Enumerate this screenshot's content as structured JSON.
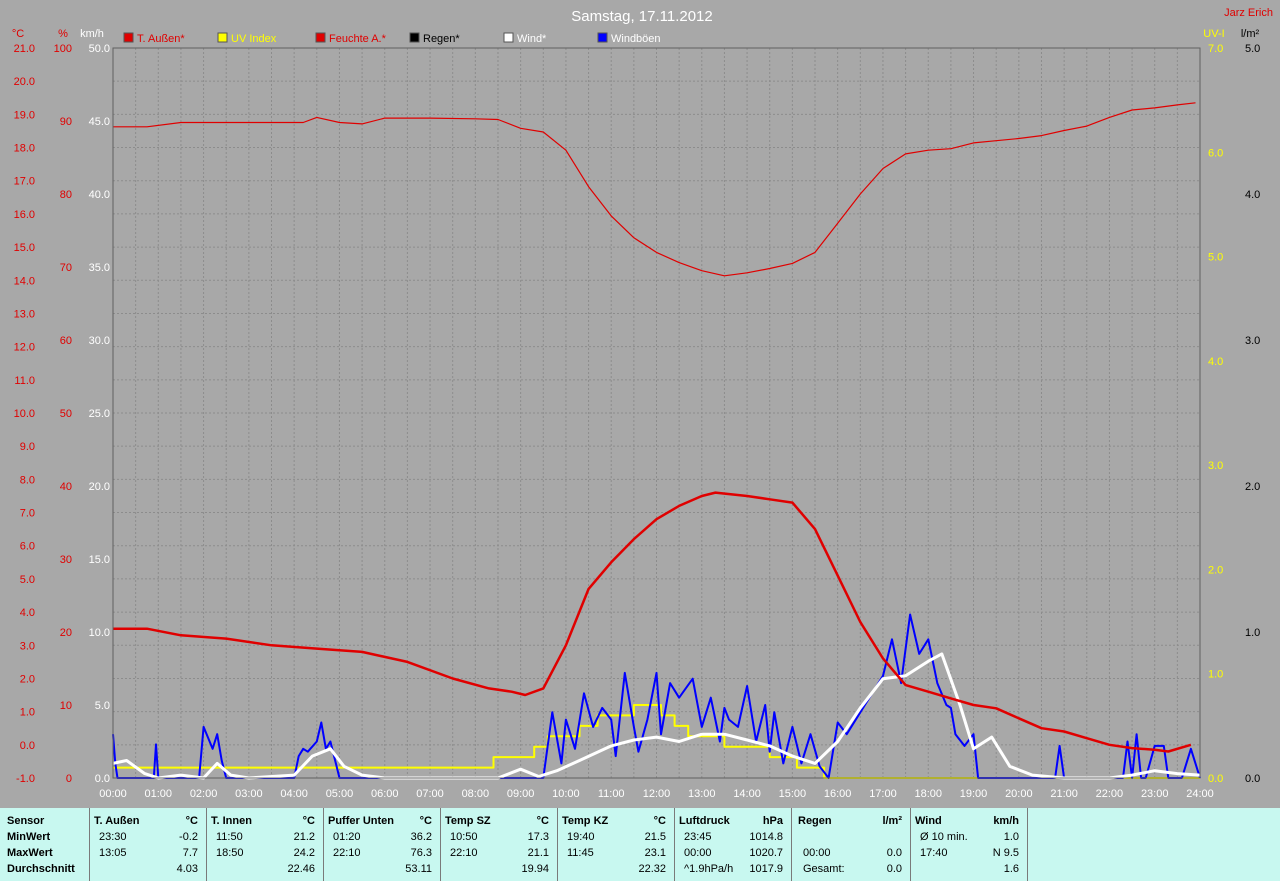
{
  "header": {
    "title": "Samstag, 17.11.2012",
    "author": "Jarz Erich"
  },
  "colors": {
    "background": "#a8a8a8",
    "plot_bg": "#a8a8a8",
    "red": "#e00000",
    "yellow": "#ffff00",
    "black": "#000000",
    "white": "#ffffff",
    "blue": "#0000ff",
    "table_bg": "#c8f8f0"
  },
  "legend": [
    {
      "label": "T. Außen*",
      "color": "#e00000",
      "text_color": "#e00000"
    },
    {
      "label": "UV Index",
      "color": "#ffff00",
      "text_color": "#ffff00"
    },
    {
      "label": "Feuchte A.*",
      "color": "#e00000",
      "text_color": "#e00000"
    },
    {
      "label": "Regen*",
      "color": "#000000",
      "text_color": "#000000"
    },
    {
      "label": "Wind*",
      "color": "#ffffff",
      "text_color": "#ffffff"
    },
    {
      "label": "Windböen",
      "color": "#0000ff",
      "text_color": "#ffffff"
    }
  ],
  "axes": {
    "temp": {
      "unit": "°C",
      "min": -1,
      "max": 21,
      "step": 1,
      "color": "#e00000"
    },
    "humidity": {
      "unit": "%",
      "min": 0,
      "max": 100,
      "step": 10,
      "color": "#e00000"
    },
    "wind": {
      "unit": "km/h",
      "min": 0,
      "max": 50,
      "step": 5,
      "color": "#ffffff"
    },
    "uv": {
      "unit": "UV-I",
      "min": 0,
      "max": 7,
      "step": 1,
      "color": "#ffff00"
    },
    "rain": {
      "unit": "l/m²",
      "min": 0,
      "max": 5,
      "step": 1,
      "color": "#000000"
    },
    "time_ticks": [
      "00:00",
      "01:00",
      "02:00",
      "03:00",
      "04:00",
      "05:00",
      "06:00",
      "07:00",
      "08:00",
      "09:00",
      "10:00",
      "11:00",
      "12:00",
      "13:00",
      "14:00",
      "15:00",
      "16:00",
      "17:00",
      "18:00",
      "19:00",
      "20:00",
      "21:00",
      "22:00",
      "23:00",
      "24:00"
    ]
  },
  "chart_data": {
    "type": "line",
    "title": "Samstag, 17.11.2012",
    "x_unit": "hours",
    "xlim": [
      0,
      24
    ],
    "grid": true,
    "legend_position": "top",
    "series": [
      {
        "name": "T. Außen*",
        "axis": "temp",
        "color": "#e00000",
        "x": [
          0,
          0.75,
          1.5,
          2.5,
          3.5,
          4.5,
          5.5,
          6.5,
          7.5,
          8.3,
          8.8,
          9.1,
          9.5,
          10,
          10.5,
          11,
          11.5,
          12,
          12.5,
          13,
          13.3,
          14,
          14.5,
          15,
          15.5,
          16,
          16.5,
          17,
          17.5,
          18,
          18.5,
          19,
          19.5,
          20,
          20.5,
          21,
          21.5,
          22,
          22.5,
          23,
          23.3,
          23.8
        ],
        "y": [
          3.5,
          3.5,
          3.3,
          3.2,
          3.0,
          2.9,
          2.8,
          2.5,
          2.0,
          1.7,
          1.6,
          1.5,
          1.7,
          3.0,
          4.7,
          5.5,
          6.2,
          6.8,
          7.2,
          7.5,
          7.6,
          7.5,
          7.4,
          7.3,
          6.5,
          5.1,
          3.7,
          2.6,
          1.8,
          1.6,
          1.4,
          1.2,
          1.1,
          0.8,
          0.5,
          0.4,
          0.2,
          0.0,
          -0.1,
          -0.15,
          -0.2,
          0.0
        ]
      },
      {
        "name": "Feuchte A.*",
        "axis": "humidity",
        "color": "#e00000",
        "x": [
          0,
          0.75,
          1.5,
          2.5,
          3.5,
          4.2,
          4.5,
          5,
          5.5,
          6,
          7,
          8,
          8.5,
          9,
          9.5,
          10,
          10.5,
          11,
          11.5,
          12,
          12.5,
          13,
          13.5,
          14,
          14.5,
          15,
          15.5,
          16,
          16.5,
          17,
          17.5,
          18,
          18.5,
          19,
          19.5,
          20,
          20.5,
          21,
          21.5,
          22,
          22.5,
          23,
          23.5,
          23.9
        ],
        "y": [
          89.2,
          89.2,
          89.8,
          89.8,
          89.8,
          89.8,
          90.5,
          89.8,
          89.6,
          90.4,
          90.4,
          90.3,
          90.2,
          89.0,
          88.5,
          86.0,
          81.0,
          77.0,
          74.0,
          72.0,
          70.6,
          69.5,
          68.8,
          69.2,
          69.8,
          70.5,
          72.0,
          76.0,
          80.0,
          83.5,
          85.5,
          86.0,
          86.2,
          87.0,
          87.3,
          87.6,
          88.0,
          88.7,
          89.3,
          90.5,
          91.5,
          91.8,
          92.2,
          92.5
        ]
      },
      {
        "name": "UV Index",
        "axis": "uv",
        "color": "#ffff00",
        "x": [
          0,
          8.4,
          8.4,
          9.3,
          9.3,
          9.6,
          9.6,
          10.3,
          10.3,
          10.7,
          10.7,
          11.5,
          11.5,
          12.1,
          12.1,
          12.4,
          12.4,
          12.7,
          12.7,
          13.5,
          13.5,
          14.5,
          14.5,
          15.1,
          15.1,
          15.7,
          15.7,
          20.1,
          20.1,
          24
        ],
        "y": [
          0.1,
          0.1,
          0.2,
          0.2,
          0.3,
          0.3,
          0.4,
          0.4,
          0.5,
          0.5,
          0.6,
          0.6,
          0.7,
          0.7,
          0.6,
          0.6,
          0.5,
          0.5,
          0.4,
          0.4,
          0.3,
          0.3,
          0.2,
          0.2,
          0.1,
          0.1,
          0.0,
          0.0,
          0.0,
          0.0
        ]
      },
      {
        "name": "Regen*",
        "axis": "rain",
        "color": "#000000",
        "x": [
          0,
          24
        ],
        "y": [
          0,
          0
        ]
      },
      {
        "name": "Wind*",
        "axis": "wind",
        "color": "#ffffff",
        "x": [
          0,
          0.3,
          0.7,
          1.0,
          1.5,
          2.0,
          2.3,
          2.6,
          3.0,
          4.0,
          4.4,
          4.8,
          5.1,
          5.5,
          6.0,
          7.0,
          8.5,
          9.0,
          9.4,
          9.8,
          10.3,
          11.0,
          11.5,
          12.0,
          12.5,
          13.0,
          13.5,
          14.0,
          14.5,
          15.0,
          15.5,
          16.0,
          16.5,
          17.0,
          17.5,
          18.0,
          18.3,
          18.7,
          19.0,
          19.4,
          19.8,
          20.3,
          21.0,
          22.0,
          22.5,
          23.0,
          23.5,
          24.0
        ],
        "y": [
          1.0,
          1.2,
          0.3,
          0.0,
          0.2,
          0.0,
          1.0,
          0.2,
          0.0,
          0.2,
          1.5,
          2.0,
          0.8,
          0.2,
          0.0,
          0.0,
          0.0,
          0.6,
          0.1,
          0.5,
          1.2,
          2.2,
          2.6,
          2.8,
          2.5,
          3.0,
          3.0,
          2.6,
          2.2,
          1.5,
          1.0,
          2.5,
          4.8,
          6.8,
          7.0,
          8.0,
          8.5,
          5.0,
          2.0,
          2.8,
          0.8,
          0.2,
          0.0,
          0.0,
          0.2,
          0.5,
          0.3,
          0.2
        ]
      },
      {
        "name": "Windböen",
        "axis": "wind",
        "color": "#0000ff",
        "x": [
          0,
          0.05,
          0.1,
          0.9,
          0.95,
          1.0,
          1.9,
          2.0,
          2.2,
          2.3,
          2.4,
          2.5,
          4.0,
          4.1,
          4.2,
          4.3,
          4.5,
          4.6,
          4.7,
          4.8,
          5.0,
          9.5,
          9.7,
          9.9,
          10.0,
          10.2,
          10.4,
          10.6,
          10.8,
          11.0,
          11.1,
          11.3,
          11.5,
          11.6,
          11.8,
          12.0,
          12.1,
          12.3,
          12.5,
          12.8,
          13.0,
          13.2,
          13.4,
          13.5,
          13.6,
          13.8,
          14.0,
          14.2,
          14.4,
          14.5,
          14.6,
          14.8,
          15.0,
          15.2,
          15.4,
          15.6,
          15.8,
          16.0,
          16.2,
          16.5,
          16.8,
          17.0,
          17.2,
          17.4,
          17.6,
          17.8,
          18.0,
          18.2,
          18.4,
          18.5,
          18.6,
          18.8,
          19.0,
          19.1,
          19.3,
          20.8,
          20.9,
          21.0,
          21.2,
          22.3,
          22.4,
          22.5,
          22.6,
          22.7,
          22.8,
          23.0,
          23.2,
          23.3,
          23.5,
          23.6,
          23.8,
          24.0
        ],
        "y": [
          3.0,
          1.0,
          0.0,
          0.0,
          2.3,
          0.0,
          0.0,
          3.5,
          2.0,
          3.0,
          1.2,
          0.0,
          0.0,
          1.5,
          2.0,
          1.8,
          2.5,
          3.8,
          2.0,
          2.5,
          0.0,
          0.0,
          4.5,
          1.0,
          4.0,
          2.0,
          5.8,
          3.5,
          4.8,
          4.0,
          1.5,
          7.2,
          3.5,
          1.8,
          4.0,
          7.2,
          3.0,
          6.5,
          5.5,
          6.8,
          3.5,
          5.5,
          2.5,
          4.8,
          4.0,
          3.5,
          6.3,
          2.5,
          5.0,
          1.8,
          4.5,
          1.0,
          3.5,
          1.0,
          3.0,
          0.8,
          0.0,
          3.8,
          3.0,
          4.5,
          6.0,
          7.0,
          9.5,
          6.5,
          11.2,
          8.5,
          9.5,
          6.5,
          5.0,
          4.8,
          3.0,
          2.2,
          3.0,
          0.0,
          0.0,
          0.0,
          2.2,
          0.0,
          0.0,
          0.0,
          2.5,
          0.0,
          3.0,
          0.0,
          0.0,
          2.2,
          2.2,
          0.0,
          0.0,
          0.0,
          2.0,
          0.0
        ]
      }
    ]
  },
  "stats": {
    "columns": [
      {
        "id": "sensor",
        "header": "Sensor",
        "rows": [
          "MinWert",
          "MaxWert",
          "Durchschnitt"
        ]
      },
      {
        "id": "t-aussen",
        "header": "T. Außen",
        "unit": "°C",
        "rows": [
          [
            "23:30",
            "-0.2"
          ],
          [
            "13:05",
            "7.7"
          ],
          [
            "",
            "4.03"
          ]
        ]
      },
      {
        "id": "t-innen",
        "header": "T. Innen",
        "unit": "°C",
        "rows": [
          [
            "11:50",
            "21.2"
          ],
          [
            "18:50",
            "24.2"
          ],
          [
            "",
            "22.46"
          ]
        ]
      },
      {
        "id": "puffer-unten",
        "header": "Puffer Unten",
        "unit": "°C",
        "rows": [
          [
            "01:20",
            "36.2"
          ],
          [
            "22:10",
            "76.3"
          ],
          [
            "",
            "53.11"
          ]
        ]
      },
      {
        "id": "temp-sz",
        "header": "Temp SZ",
        "unit": "°C",
        "rows": [
          [
            "10:50",
            "17.3"
          ],
          [
            "22:10",
            "21.1"
          ],
          [
            "",
            "19.94"
          ]
        ]
      },
      {
        "id": "temp-kz",
        "header": "Temp KZ",
        "unit": "°C",
        "rows": [
          [
            "19:40",
            "21.5"
          ],
          [
            "11:45",
            "23.1"
          ],
          [
            "",
            "22.32"
          ]
        ]
      },
      {
        "id": "luftdruck",
        "header": "Luftdruck",
        "unit": "hPa",
        "rows": [
          [
            "23:45",
            "1014.8"
          ],
          [
            "00:00",
            "1020.7"
          ],
          [
            "^1.9hPa/h",
            "1017.9"
          ]
        ]
      },
      {
        "id": "regen",
        "header": "Regen",
        "unit": "l/m²",
        "rows": [
          [
            "",
            ""
          ],
          [
            "00:00",
            "0.0"
          ],
          [
            "Gesamt:",
            "0.0"
          ]
        ]
      },
      {
        "id": "wind",
        "header": "Wind",
        "unit": "km/h",
        "rows": [
          [
            "Ø 10 min.",
            "1.0"
          ],
          [
            "17:40",
            "N 9.5"
          ],
          [
            "",
            "1.6"
          ]
        ]
      }
    ]
  }
}
